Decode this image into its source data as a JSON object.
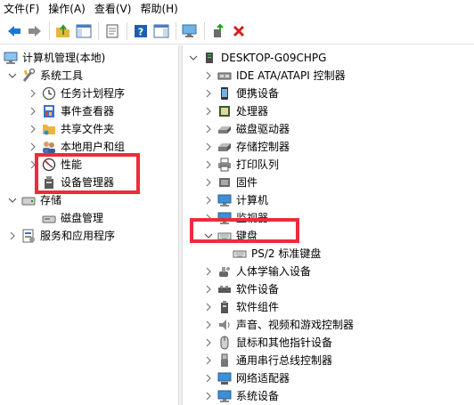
{
  "menu": [
    "文件(F)",
    "操作(A)",
    "查看(V)",
    "帮助(H)"
  ],
  "toolbar": {
    "icons": [
      "back-arrow-icon",
      "forward-arrow-icon",
      "up-folder-icon",
      "show-hide-tree-icon",
      "export-list-icon",
      "help-icon",
      "action-pane-icon",
      "scan-hardware-icon",
      "update-driver-icon",
      "uninstall-x-icon"
    ]
  },
  "left_tree": [
    {
      "label": "计算机管理(本地)",
      "expanded": true,
      "icon": "computer-management-icon"
    },
    {
      "label": "系统工具",
      "expanded": true,
      "icon": "system-tools-icon"
    },
    {
      "label": "任务计划程序",
      "expanded": false,
      "icon": "task-scheduler-icon"
    },
    {
      "label": "事件查看器",
      "expanded": false,
      "icon": "event-viewer-icon"
    },
    {
      "label": "共享文件夹",
      "expanded": false,
      "icon": "shared-folders-icon"
    },
    {
      "label": "本地用户和组",
      "expanded": false,
      "icon": "local-users-icon"
    },
    {
      "label": "性能",
      "expanded": false,
      "icon": "performance-icon"
    },
    {
      "label": "设备管理器",
      "expanded": null,
      "icon": "device-manager-icon"
    },
    {
      "label": "存储",
      "expanded": true,
      "icon": "storage-icon"
    },
    {
      "label": "磁盘管理",
      "expanded": null,
      "icon": "disk-management-icon"
    },
    {
      "label": "服务和应用程序",
      "expanded": false,
      "icon": "services-apps-icon"
    }
  ],
  "right_tree": [
    {
      "label": "DESKTOP-G09CHPG",
      "expanded": true,
      "icon": "computer-icon"
    },
    {
      "label": "IDE ATA/ATAPI 控制器",
      "icon": "ide-controller-icon"
    },
    {
      "label": "便携设备",
      "icon": "portable-device-icon"
    },
    {
      "label": "处理器",
      "icon": "processor-icon"
    },
    {
      "label": "磁盘驱动器",
      "icon": "disk-drive-icon"
    },
    {
      "label": "存储控制器",
      "icon": "storage-controller-icon"
    },
    {
      "label": "打印队列",
      "icon": "printer-icon"
    },
    {
      "label": "固件",
      "icon": "firmware-icon"
    },
    {
      "label": "计算机",
      "icon": "computer-icon"
    },
    {
      "label": "监视器",
      "icon": "monitor-icon"
    },
    {
      "label": "键盘",
      "expanded": true,
      "icon": "keyboard-icon"
    },
    {
      "label": "PS/2 标准键盘",
      "icon": "keyboard-icon"
    },
    {
      "label": "人体学输入设备",
      "icon": "hid-icon"
    },
    {
      "label": "软件设备",
      "icon": "software-device-icon"
    },
    {
      "label": "软件组件",
      "icon": "software-component-icon"
    },
    {
      "label": "声音、视频和游戏控制器",
      "icon": "audio-icon"
    },
    {
      "label": "鼠标和其他指针设备",
      "icon": "mouse-icon"
    },
    {
      "label": "通用串行总线控制器",
      "icon": "usb-icon"
    },
    {
      "label": "网络适配器",
      "icon": "network-adapter-icon"
    },
    {
      "label": "系统设备",
      "icon": "system-device-icon"
    }
  ],
  "colors": {
    "highlight": "#ee2b3b",
    "accent": "#1e76d3"
  }
}
